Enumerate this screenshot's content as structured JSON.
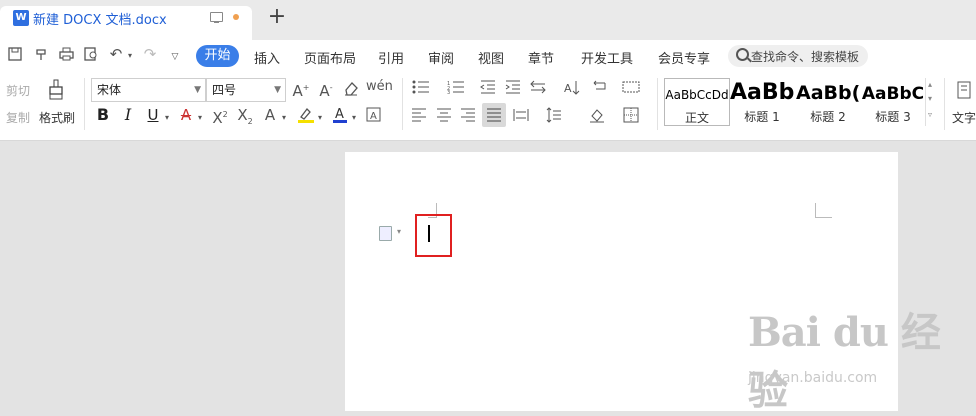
{
  "tabbar": {
    "doc_title": "新建 DOCX 文档.docx",
    "doc_icon_letter": "W",
    "new_tab": "+"
  },
  "menu_tabs": [
    "开始",
    "插入",
    "页面布局",
    "引用",
    "审阅",
    "视图",
    "章节",
    "开发工具",
    "会员专享"
  ],
  "search": {
    "placeholder": "查找命令、搜索模板"
  },
  "clipboard": {
    "cut": "剪切",
    "copy": "复制",
    "format_painter": "格式刷"
  },
  "font": {
    "family": "宋体",
    "size": "四号"
  },
  "styles": [
    {
      "sample": "AaBbCcDd",
      "name": "正文"
    },
    {
      "sample": "AaBb",
      "name": "标题 1"
    },
    {
      "sample": "AaBb(",
      "name": "标题 2"
    },
    {
      "sample": "AaBbC",
      "name": "标题 3"
    }
  ],
  "text_tool_label": "文字",
  "watermark": {
    "brand": "Bai du 经验",
    "url": "jingyan.baidu.com"
  },
  "colors": {
    "accent": "#3a7ee8",
    "highlight_box": "#e02020",
    "font_color_underline": "#2040d0",
    "highlight_color": "#f5e000"
  }
}
